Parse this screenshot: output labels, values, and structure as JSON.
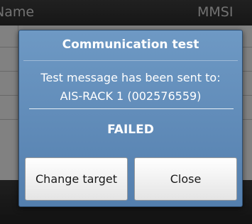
{
  "background_list": {
    "header": {
      "name_label": "Name",
      "mmsi_label": "MMSI"
    }
  },
  "dialog": {
    "title": "Communication test",
    "message_line1": "Test message has been sent to:",
    "message_line2": "AIS-RACK 1 (002576559)",
    "status": "FAILED",
    "buttons": {
      "change_target": "Change target",
      "close": "Close"
    }
  },
  "colors": {
    "dialog_bg": "#6e99c4",
    "button_bg": "#ffffff",
    "header_bg": "#333333"
  }
}
